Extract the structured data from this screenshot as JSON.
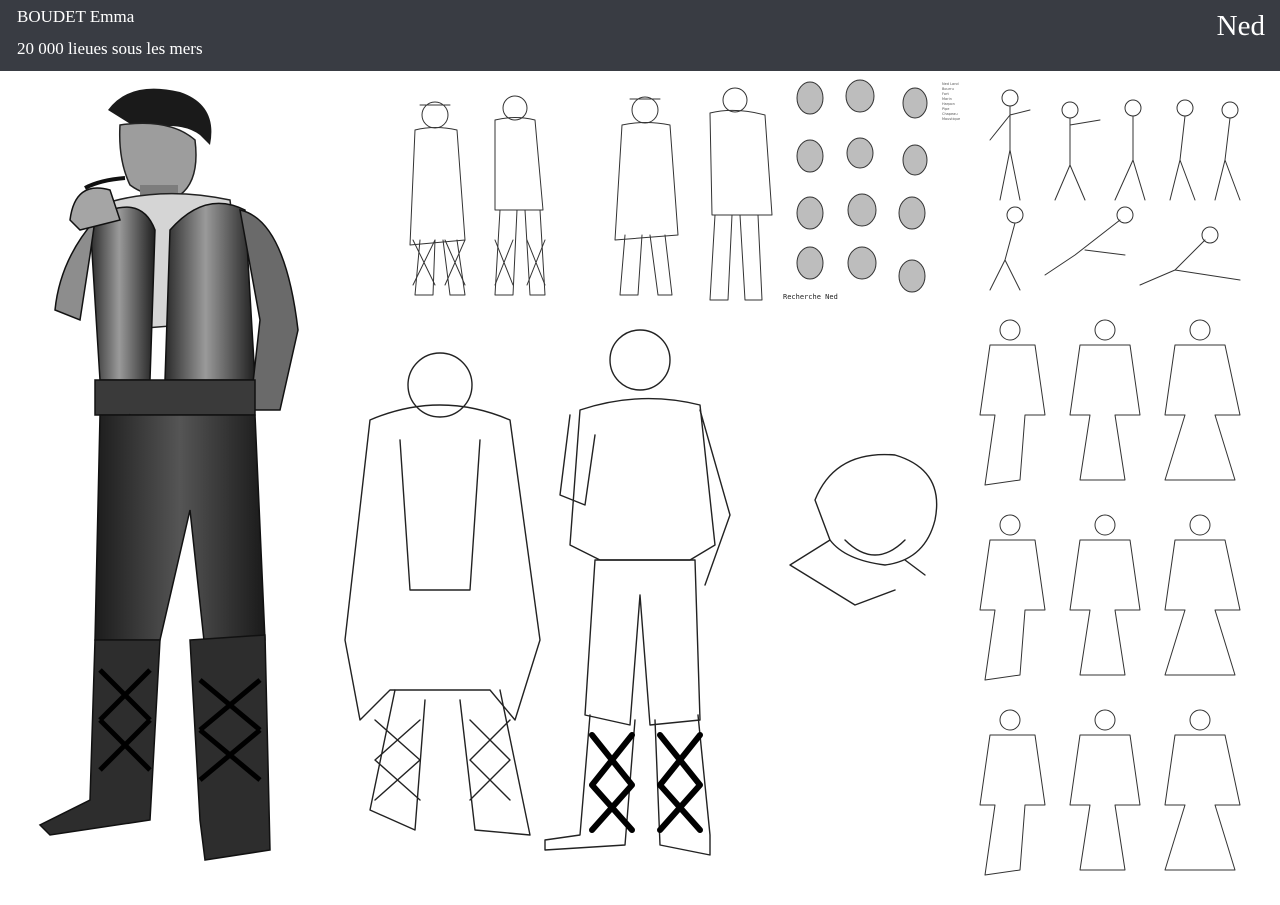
{
  "header": {
    "author": "BOUDET Emma",
    "subtitle": "20 000 lieues sous les mers",
    "character_name": "Ned"
  },
  "caption": "Recherche Ned",
  "sidelist": [
    "Ned Land",
    "Bourru",
    "Fort",
    "Marin",
    "Harpon",
    "Pipe",
    "Chapeau",
    "Moustique"
  ],
  "colors": {
    "header_bg": "#393c43",
    "header_text": "#ffffff",
    "page_bg": "#ffffff"
  },
  "icons": [
    "ink-sketch-figure",
    "shaded-render-figure",
    "head-study",
    "pose-study"
  ]
}
